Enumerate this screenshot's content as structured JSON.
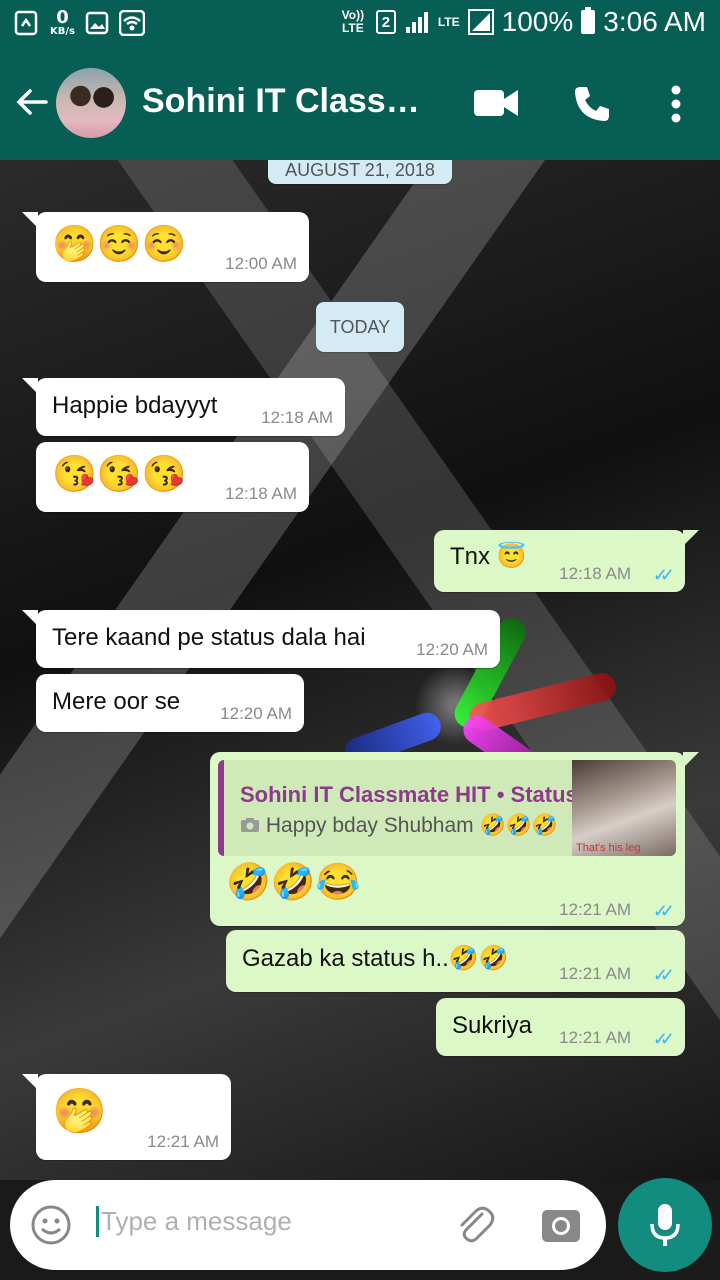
{
  "status_bar": {
    "speed_value": "0",
    "speed_unit": "KB/s",
    "volte": "Vo)) LTE",
    "sim_slot": "2",
    "network_type": "LTE",
    "battery_percent": "100%",
    "time": "3:06 AM"
  },
  "header": {
    "title": "Sohini IT Classm…",
    "icons": [
      "back-arrow-icon",
      "video-call-icon",
      "voice-call-icon",
      "more-options-icon"
    ]
  },
  "chat": {
    "date_top": "AUGUST 21, 2018",
    "date_today": "TODAY",
    "messages": [
      {
        "dir": "in",
        "text": "🤭☺️☺️",
        "time": "12:00 AM"
      },
      {
        "dir": "in",
        "text": "Happie bdayyyt",
        "time": "12:18 AM"
      },
      {
        "dir": "in",
        "text": "😘😘😘",
        "time": "12:18 AM"
      },
      {
        "dir": "out",
        "text": "Tnx 😇",
        "time": "12:18 AM",
        "status": "read"
      },
      {
        "dir": "in",
        "text": "Tere kaand pe status dala hai",
        "time": "12:20 AM"
      },
      {
        "dir": "in",
        "text": "Mere oor se",
        "time": "12:20 AM"
      },
      {
        "dir": "out",
        "quote_name": "Sohini IT Classmate HIT • Status",
        "quote_text": "Happy bday Shubham 🤣🤣🤣",
        "quote_thumb_text": "That's his leg",
        "text": "🤣🤣😂",
        "time": "12:21 AM",
        "status": "read"
      },
      {
        "dir": "out",
        "text": "Gazab ka status h..🤣🤣",
        "time": "12:21 AM",
        "status": "read"
      },
      {
        "dir": "out",
        "text": "Sukriya",
        "time": "12:21 AM",
        "status": "read"
      },
      {
        "dir": "in",
        "text": "🤭",
        "time": "12:21 AM"
      }
    ]
  },
  "composer": {
    "placeholder": "Type a message",
    "icons": [
      "emoji-icon",
      "attach-icon",
      "camera-icon",
      "mic-icon"
    ]
  },
  "colors": {
    "header": "#075e54",
    "outgoing_bubble": "#dcf8c6",
    "incoming_bubble": "#ffffff",
    "read_ticks": "#34b7f1",
    "accent": "#128c7e"
  }
}
